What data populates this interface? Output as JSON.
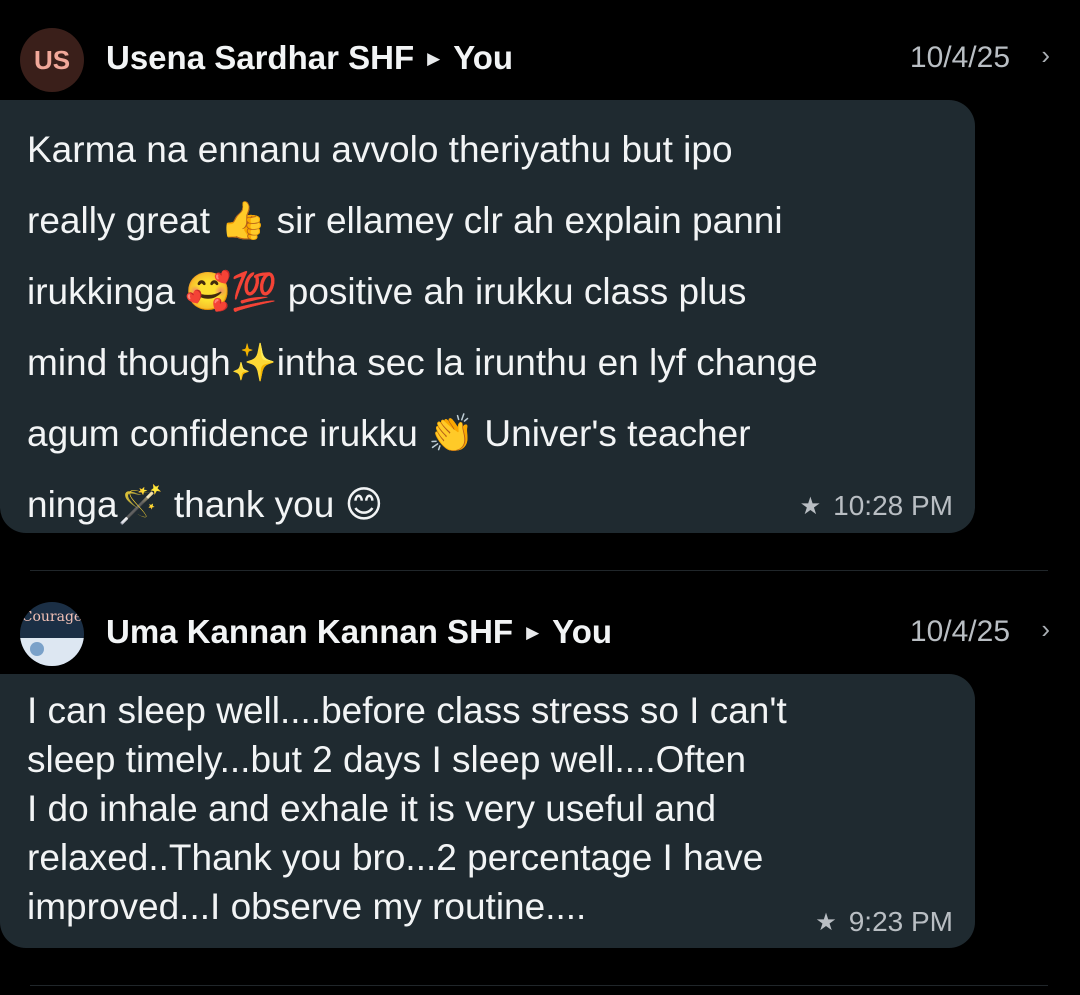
{
  "messages": [
    {
      "avatar_initials": "US",
      "sender": "Usena Sardhar SHF",
      "recipient": "You",
      "date": "10/4/25",
      "lines": [
        "Karma na ennanu avvolo theriyathu but ipo",
        "really great 👍 sir ellamey clr ah explain panni",
        "irukkinga 🥰💯 positive ah irukku class plus",
        "mind though✨intha sec la irunthu en lyf change",
        "agum confidence irukku 👏 Univer's teacher",
        "ninga🪄 thank you 😊"
      ],
      "time": "10:28 PM",
      "starred": true
    },
    {
      "avatar_image_text": "Courage",
      "sender": "Uma Kannan Kannan SHF",
      "recipient": "You",
      "date": "10/4/25",
      "lines": [
        "I can sleep well....before class   stress so I can't",
        "sleep timely...but 2 days I  sleep well....Often",
        "I do inhale and exhale it is very useful and",
        "relaxed..Thank you bro...2  percentage I have",
        "improved...I observe my routine...."
      ],
      "time": "9:23 PM",
      "starred": true
    }
  ],
  "icons": {
    "arrow": "play-arrow-icon",
    "chevron": "chevron-right-icon",
    "star": "star-icon"
  },
  "colors": {
    "background": "#000000",
    "bubble": "#1f2a30",
    "text": "#f2f4f5",
    "meta": "#b9bec3"
  }
}
